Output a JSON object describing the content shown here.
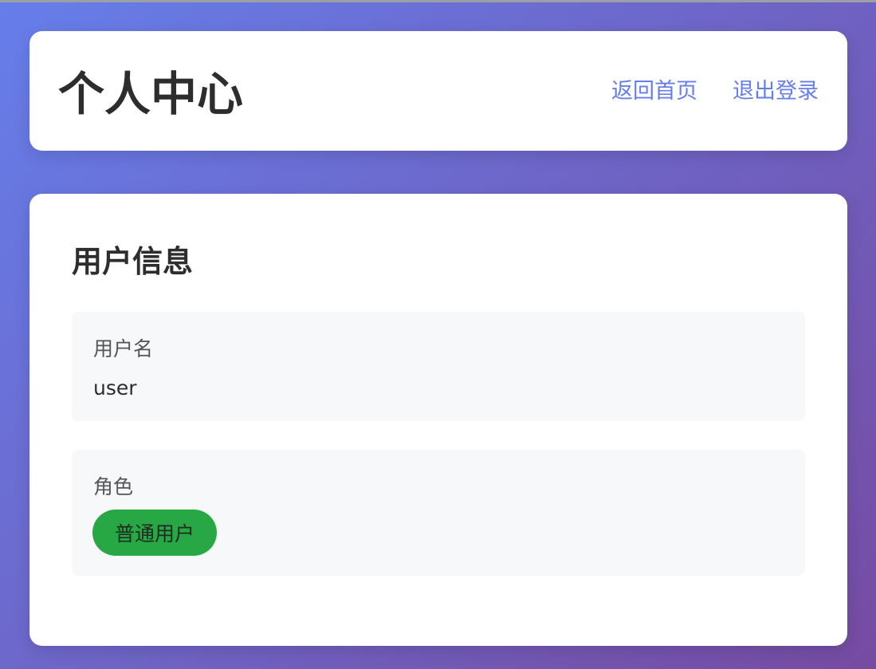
{
  "header": {
    "title": "个人中心",
    "nav": [
      {
        "label": "返回首页"
      },
      {
        "label": "退出登录"
      }
    ]
  },
  "user_info": {
    "section_title": "用户信息",
    "username": {
      "label": "用户名",
      "value": "user"
    },
    "role": {
      "label": "角色",
      "value": "普通用户"
    }
  },
  "colors": {
    "gradient_start": "#667eea",
    "gradient_end": "#764ba2",
    "link": "#667eea",
    "role_badge": "#28a745",
    "item_background": "#f7f8fa"
  }
}
